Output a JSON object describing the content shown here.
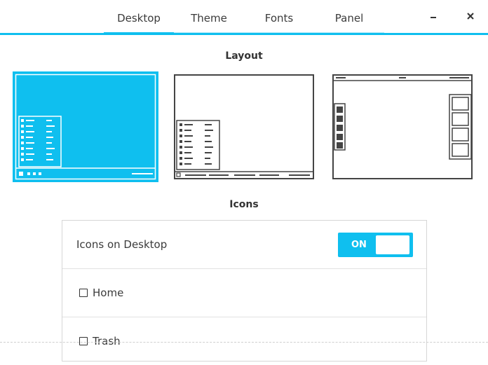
{
  "header": {
    "tabs": [
      {
        "label": "Desktop",
        "active": true
      },
      {
        "label": "Theme",
        "active": false
      },
      {
        "label": "Fonts",
        "active": false
      },
      {
        "label": "Panel",
        "active": false
      }
    ],
    "minimize_icon": "minimize-icon",
    "close_icon": "close-icon"
  },
  "layout": {
    "title": "Layout",
    "options": [
      {
        "name": "layout-bottom-panel",
        "selected": true
      },
      {
        "name": "layout-bottom-bar",
        "selected": false
      },
      {
        "name": "layout-top-bar-side-dock",
        "selected": false
      }
    ]
  },
  "icons": {
    "title": "Icons",
    "desktop_toggle": {
      "label": "Icons on Desktop",
      "state": "ON"
    },
    "items": [
      {
        "label": "Home",
        "checked": false
      },
      {
        "label": "Trash",
        "checked": false
      }
    ]
  },
  "colors": {
    "accent": "#0fbfef",
    "accent_light": "#b5e9f8",
    "dark": "#3b3b3b"
  }
}
